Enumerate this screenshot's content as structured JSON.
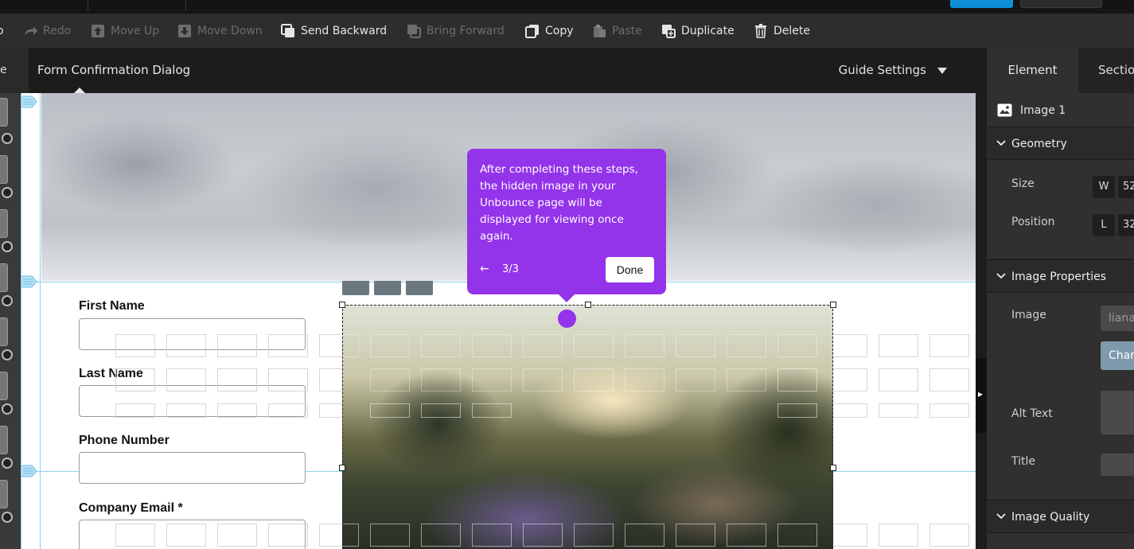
{
  "toolbar": {
    "items": [
      {
        "label": "Redo",
        "icon": "redo-icon",
        "enabled": false
      },
      {
        "label": "Move Up",
        "icon": "move-up-icon",
        "enabled": false
      },
      {
        "label": "Move Down",
        "icon": "move-down-icon",
        "enabled": false
      },
      {
        "label": "Send Backward",
        "icon": "send-backward-icon",
        "enabled": true
      },
      {
        "label": "Bring Forward",
        "icon": "bring-forward-icon",
        "enabled": false
      },
      {
        "label": "Copy",
        "icon": "copy-icon",
        "enabled": true
      },
      {
        "label": "Paste",
        "icon": "paste-icon",
        "enabled": false
      },
      {
        "label": "Duplicate",
        "icon": "duplicate-icon",
        "enabled": true
      },
      {
        "label": "Delete",
        "icon": "trash-icon",
        "enabled": true
      }
    ]
  },
  "canvas_header": {
    "left_tab_partial": "e",
    "title": "Form Confirmation Dialog",
    "guide_settings": "Guide Settings"
  },
  "form": {
    "fields": [
      {
        "label": "First Name",
        "value": ""
      },
      {
        "label": "Last Name",
        "value": ""
      },
      {
        "label": "Phone Number",
        "value": ""
      },
      {
        "label": "Company Email *",
        "value": ""
      }
    ]
  },
  "tour": {
    "message": "After completing these steps, the hidden image in your Unbounce page will be displayed for viewing once again.",
    "back_arrow": "←",
    "step": "3/3",
    "done_label": "Done",
    "accent": "#9333ea"
  },
  "panel": {
    "tabs": [
      "Element",
      "Sectio"
    ],
    "element_name": "Image 1",
    "sections": {
      "geometry": "Geometry",
      "image_properties": "Image Properties",
      "image_quality": "Image Quality"
    },
    "geometry": {
      "size_label": "Size",
      "size_w_label": "W",
      "size_w_value": "52",
      "position_label": "Position",
      "position_l_label": "L",
      "position_l_value": "32"
    },
    "image_props": {
      "image_label": "Image",
      "image_value": "liana",
      "change_button": "Char",
      "alt_text_label": "Alt Text",
      "title_label": "Title"
    }
  },
  "colors": {
    "toolbar_bg": "#2d2d2d",
    "accent_blue": "#0e8fd8",
    "guide_line": "#8fd0f0",
    "tour_purple": "#9333ea"
  }
}
